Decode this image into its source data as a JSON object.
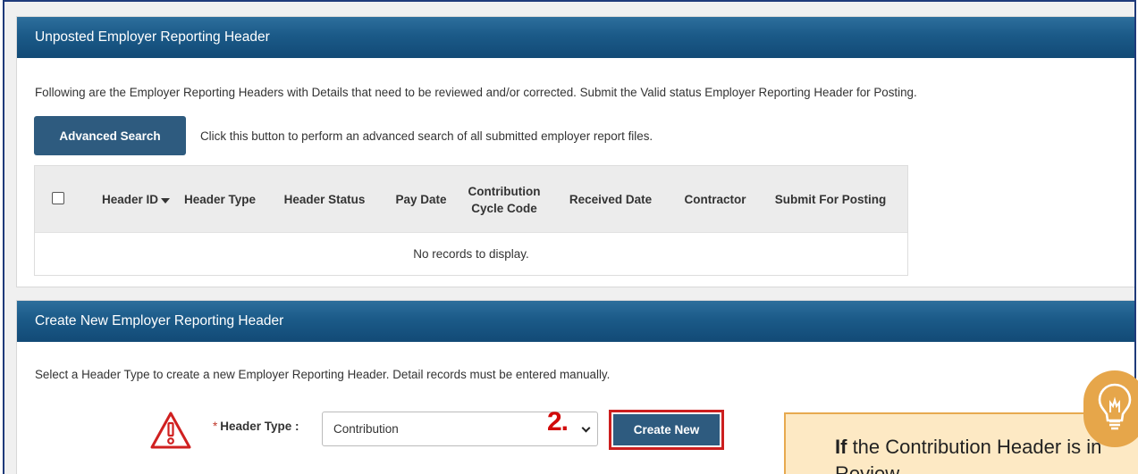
{
  "unposted": {
    "title": "Unposted Employer Reporting Header",
    "description": "Following are the Employer Reporting Headers with Details that need to be reviewed and/or corrected. Submit the Valid status Employer Reporting Header for Posting.",
    "advanced_search_label": "Advanced Search",
    "advanced_search_hint": "Click this button to perform an advanced search of all submitted employer report files.",
    "columns": [
      "Header ID",
      "Header Type",
      "Header Status",
      "Pay Date",
      "Contribution Cycle Code",
      "Received Date",
      "Contractor",
      "Submit For Posting"
    ],
    "empty_message": "No records to display."
  },
  "create": {
    "title": "Create New Employer Reporting Header",
    "description": "Select a Header Type to create a new Employer Reporting Header. Detail records must be entered manually.",
    "header_type_label": "Header Type :",
    "required_marker": "*",
    "header_type_value": "Contribution",
    "create_button_label": "Create New"
  },
  "annotation": {
    "step_number": "2.",
    "note_bold": "If",
    "note_text": " the Contribution Header is in Review"
  },
  "colors": {
    "header_blue": "#1b5a88",
    "button_blue": "#2e5b7f",
    "highlight_red": "#cc1f1f",
    "note_bg": "#fde9c4",
    "note_border": "#e7a94f"
  },
  "icons": [
    "sort-desc-icon",
    "warning-icon",
    "chevron-down-icon",
    "lightbulb-icon"
  ]
}
